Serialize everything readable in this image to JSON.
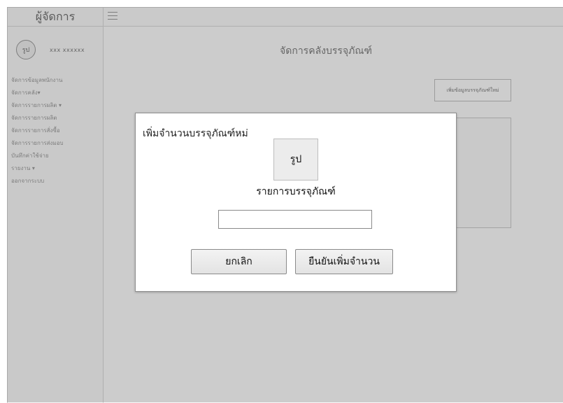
{
  "sidebar": {
    "brand": "ผู้จัดการ",
    "avatar_text": "รูป",
    "user_name": "xxx xxxxxx",
    "items": [
      {
        "label": "จัดการข้อมูลพนักงาน"
      },
      {
        "label": "จัดการคลัง▾"
      },
      {
        "label": "จัดการรายการผลิต ▾"
      },
      {
        "label": "จัดการรายการผลิต"
      },
      {
        "label": "จัดการรายการสั่งซื้อ"
      },
      {
        "label": "จัดการรายการส่งมอบ"
      },
      {
        "label": "บันทึกค่าใช้จ่าย"
      },
      {
        "label": "รายงาน ▾"
      },
      {
        "label": "ออกจากระบบ"
      }
    ]
  },
  "topbar": {
    "menu_icon": "hamburger-icon"
  },
  "main": {
    "title": "จัดการคลังบรรจุภัณฑ์",
    "add_button": "เพิ่มข้อมูลบรรจุภัณฑ์ใหม่"
  },
  "modal": {
    "title": "เพิ่มจำนวนบรรจุภัณฑ์หม่",
    "image_placeholder": "รูป",
    "item_label": "รายการบรรจุภัณฑ์",
    "input_value": "",
    "input_placeholder": "",
    "cancel_label": "ยกเลิก",
    "confirm_label": "ยืนยันเพิ่มจำนวน"
  }
}
